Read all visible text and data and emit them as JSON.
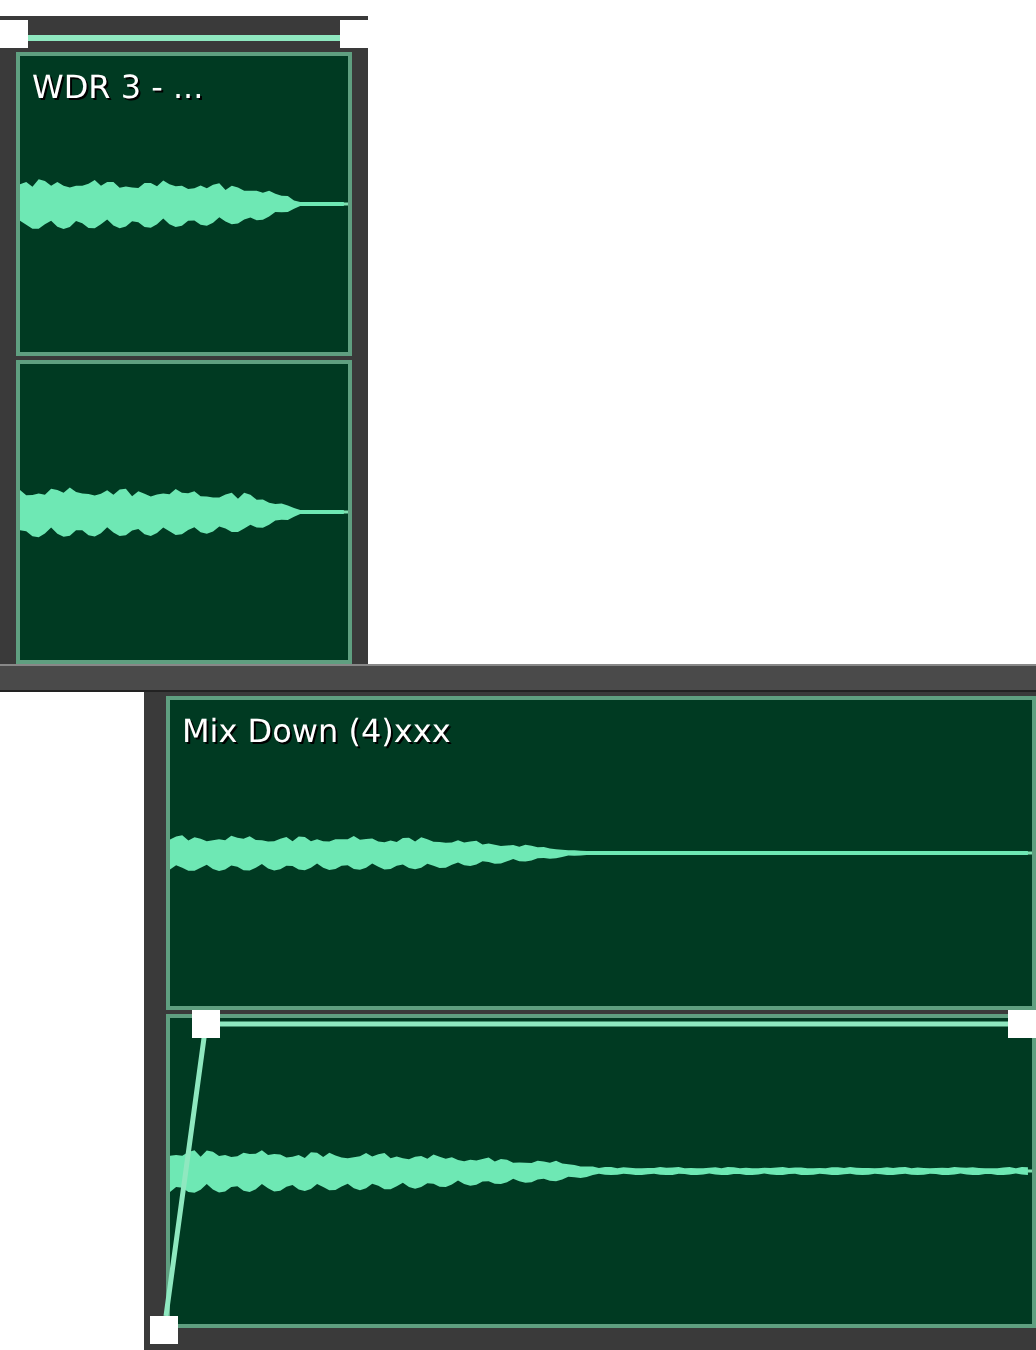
{
  "clips": [
    {
      "title": "WDR 3 - ...",
      "fade_in": false
    },
    {
      "title": "Mix Down (4)xxx",
      "fade_in": true
    }
  ]
}
